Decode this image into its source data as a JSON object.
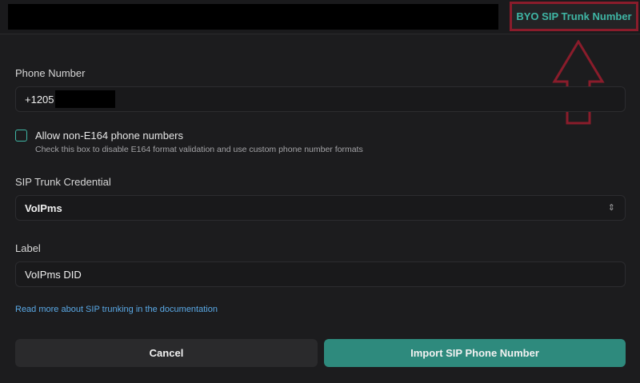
{
  "header": {
    "tab_label": "BYO SIP Trunk Number"
  },
  "form": {
    "phone_label": "Phone Number",
    "phone_value": "+1205",
    "e164_checkbox_label": "Allow non-E164 phone numbers",
    "e164_checkbox_checked": false,
    "e164_help": "Check this box to disable E164 format validation and use custom phone number formats",
    "credential_label": "SIP Trunk Credential",
    "credential_value": "VoIPms",
    "label_label": "Label",
    "label_value": "VoIPms DID",
    "docs_link": "Read more about SIP trunking in the documentation"
  },
  "actions": {
    "cancel_label": "Cancel",
    "import_label": "Import SIP Phone Number"
  },
  "colors": {
    "accent": "#3fb6a5",
    "primary_button": "#2e8a7d",
    "annotation": "#8a1c2b",
    "link": "#5aa9e6"
  },
  "icons": [
    "chevron-up-down-icon",
    "up-arrow-annotation"
  ]
}
